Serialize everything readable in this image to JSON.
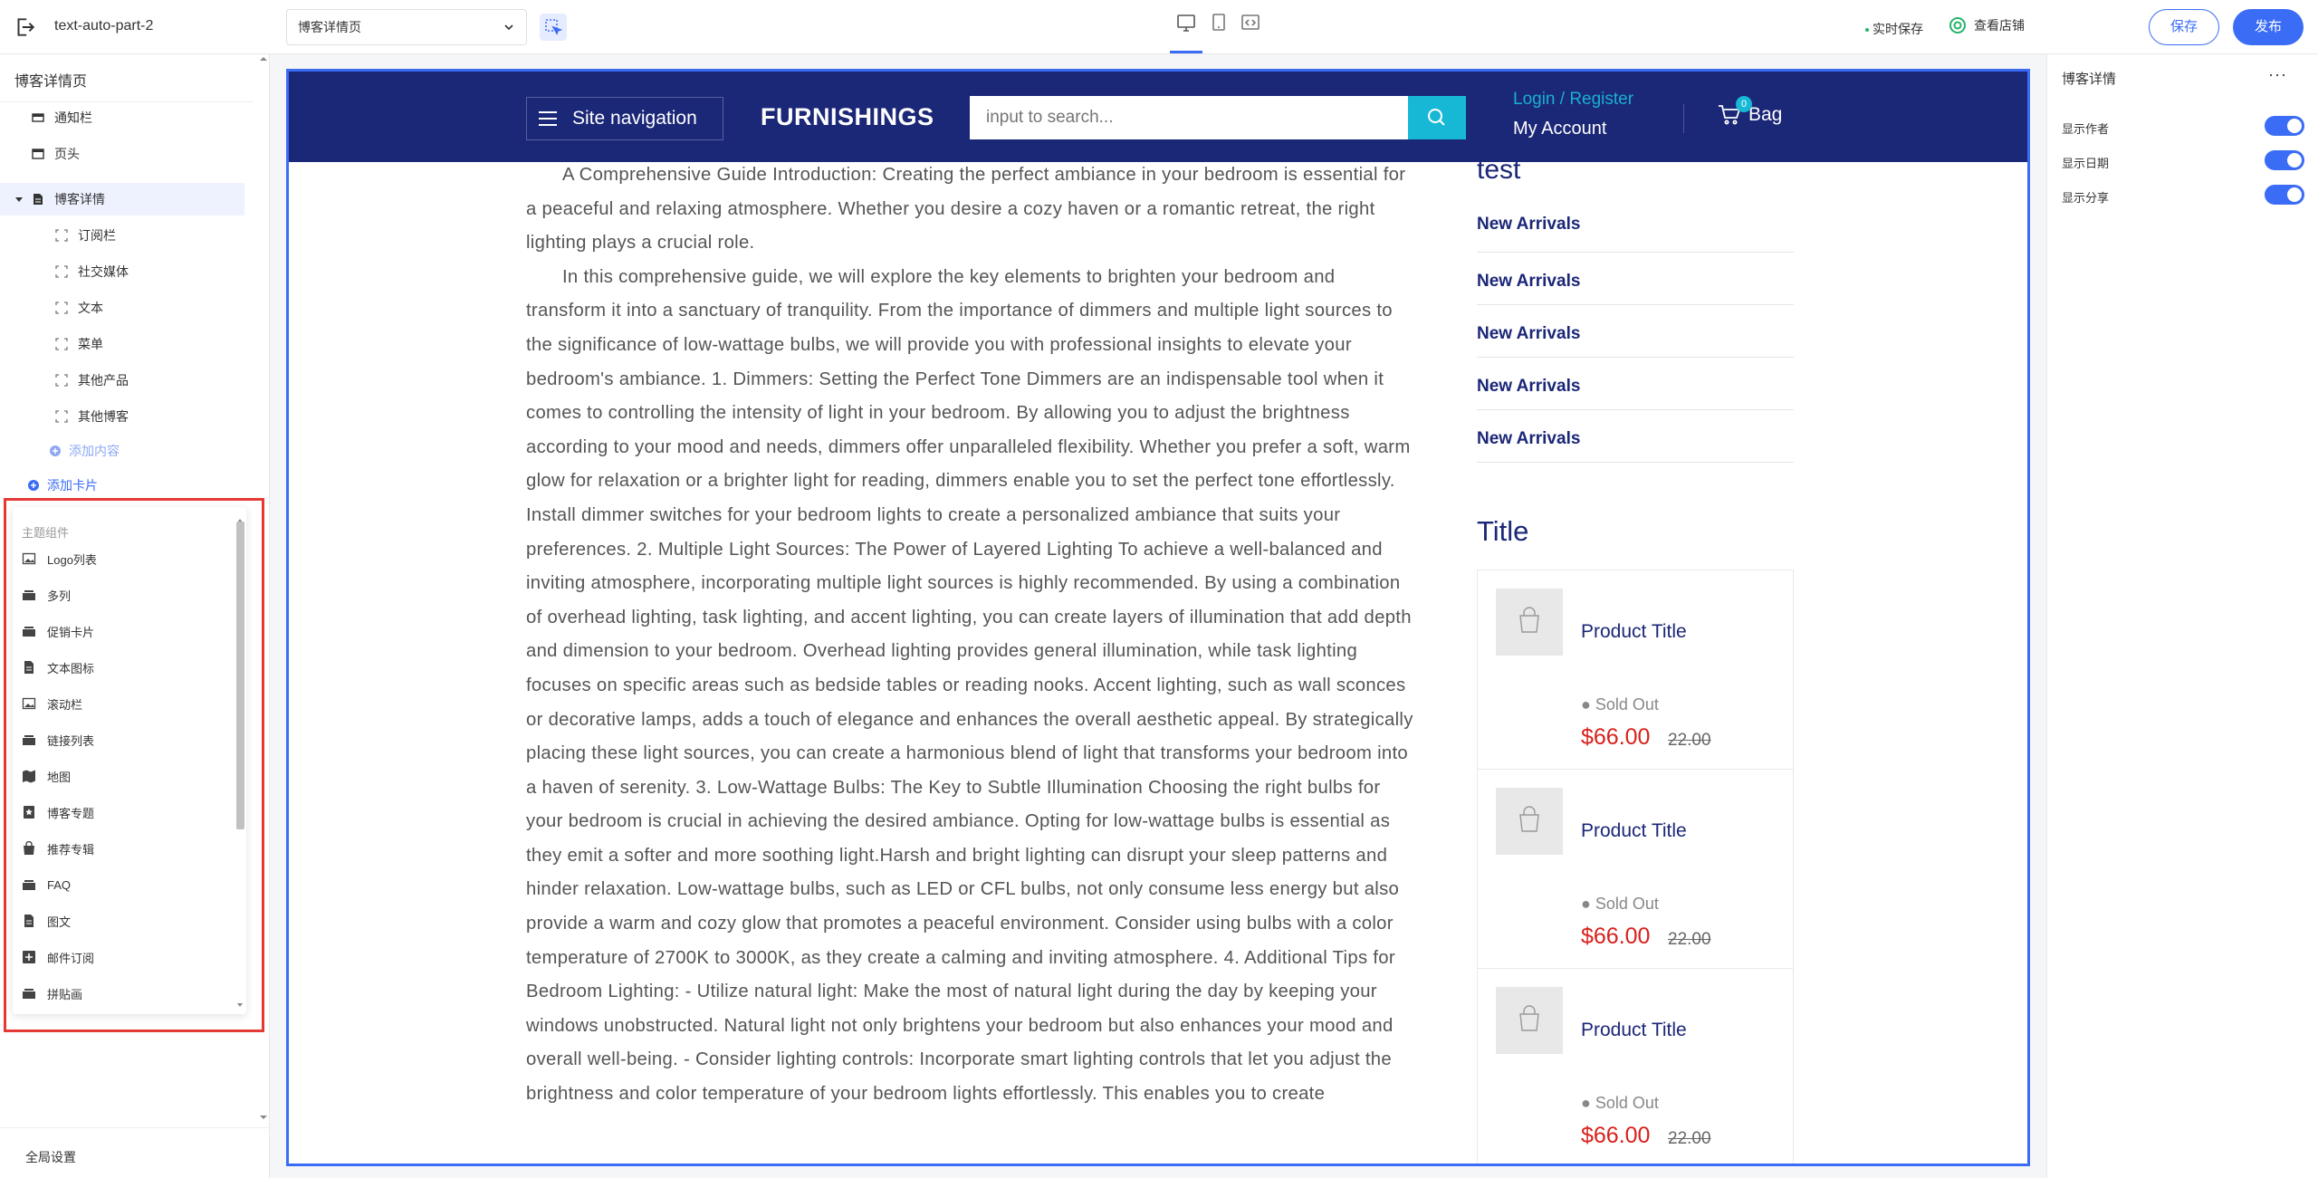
{
  "topbar": {
    "store_name": "text-auto-part-2",
    "page_select": "博客详情页",
    "autosave": "实时保存",
    "view_store": "查看店铺",
    "save": "保存",
    "publish": "发布"
  },
  "left_panel": {
    "title": "博客详情页",
    "tree": {
      "notice_bar": "通知栏",
      "header": "页头",
      "blog_detail": "博客详情",
      "children": [
        "订阅栏",
        "社交媒体",
        "文本",
        "菜单",
        "其他产品",
        "其他博客"
      ],
      "add_content": "添加内容",
      "add_card": "添加卡片"
    },
    "components": {
      "heading": "主题组件",
      "items": [
        "Logo列表",
        "多列",
        "促销卡片",
        "文本图标",
        "滚动栏",
        "链接列表",
        "地图",
        "博客专题",
        "推荐专辑",
        "FAQ",
        "图文",
        "邮件订阅",
        "拼贴画"
      ]
    },
    "global_settings": "全局设置"
  },
  "site": {
    "nav_label": "Site navigation",
    "logo": "FURNISHINGS",
    "search_placeholder": "input to search...",
    "login": "Login / Register",
    "account": "My Account",
    "bag": "Bag",
    "bag_count": "0"
  },
  "article": {
    "paragraphs": [
      "A Comprehensive Guide Introduction: Creating the perfect ambiance in your bedroom is essential for a peaceful and relaxing atmosphere. Whether you desire a cozy haven or a romantic retreat, the right lighting plays a crucial role.",
      "In this comprehensive guide, we will explore the key elements to brighten your bedroom and transform it into a sanctuary of tranquility. From the importance of dimmers and multiple light sources to the significance of low-wattage bulbs, we will provide you with professional insights to elevate your bedroom's ambiance. 1. Dimmers: Setting the Perfect Tone Dimmers are an indispensable tool when it comes to controlling the intensity of light in your bedroom. By allowing you to adjust the brightness according to your mood and needs, dimmers offer unparalleled flexibility. Whether you prefer a soft, warm glow for relaxation or a brighter light for reading, dimmers enable you to set the perfect tone effortlessly. Install dimmer switches for your bedroom lights to create a personalized ambiance that suits your preferences. 2. Multiple Light Sources: The Power of Layered Lighting To achieve a well-balanced and inviting atmosphere, incorporating multiple light sources is highly recommended. By using a combination of overhead lighting, task lighting, and accent lighting, you can create layers of illumination that add depth and dimension to your bedroom. Overhead lighting provides general illumination, while task lighting focuses on specific areas such as bedside tables or reading nooks. Accent lighting, such as wall sconces or decorative lamps, adds a touch of elegance and enhances the overall aesthetic appeal. By strategically placing these light sources, you can create a harmonious blend of light that transforms your bedroom into a haven of serenity. 3. Low-Wattage Bulbs: The Key to Subtle Illumination Choosing the right bulbs for your bedroom is crucial in achieving the desired ambiance. Opting for low-wattage bulbs is essential as they emit a softer and more soothing light.Harsh and bright lighting can disrupt your sleep patterns and hinder relaxation. Low-wattage bulbs, such as LED or CFL bulbs, not only consume less energy but also provide a warm and cozy glow that promotes a peaceful environment. Consider using bulbs with a color temperature of 2700K to 3000K, as they create a calming and inviting atmosphere. 4. Additional Tips for Bedroom Lighting: - Utilize natural light: Make the most of natural light during the day by keeping your windows unobstructed. Natural light not only brightens your bedroom but also enhances your mood and overall well-being. - Consider lighting controls: Incorporate smart lighting controls that let you adjust the brightness and color temperature of your bedroom lights effortlessly. This enables you to create"
    ]
  },
  "sidebar": {
    "heading": "test",
    "links": [
      "New Arrivals",
      "New Arrivals",
      "New Arrivals",
      "New Arrivals",
      "New Arrivals"
    ],
    "products_title": "Title",
    "products": [
      {
        "title": "Product Title",
        "status": "Sold Out",
        "price": "$66.00",
        "old_price": "22.00"
      },
      {
        "title": "Product Title",
        "status": "Sold Out",
        "price": "$66.00",
        "old_price": "22.00"
      },
      {
        "title": "Product Title",
        "status": "Sold Out",
        "price": "$66.00",
        "old_price": "22.00"
      }
    ]
  },
  "right_panel": {
    "title": "博客详情",
    "more": "···",
    "options": [
      "显示作者",
      "显示日期",
      "显示分享"
    ]
  },
  "colors": {
    "accent": "#3b6cf5",
    "site_header": "#1b2777",
    "search_button": "#17b8d6",
    "price": "#d8201c",
    "highlight_box": "#e53935"
  }
}
